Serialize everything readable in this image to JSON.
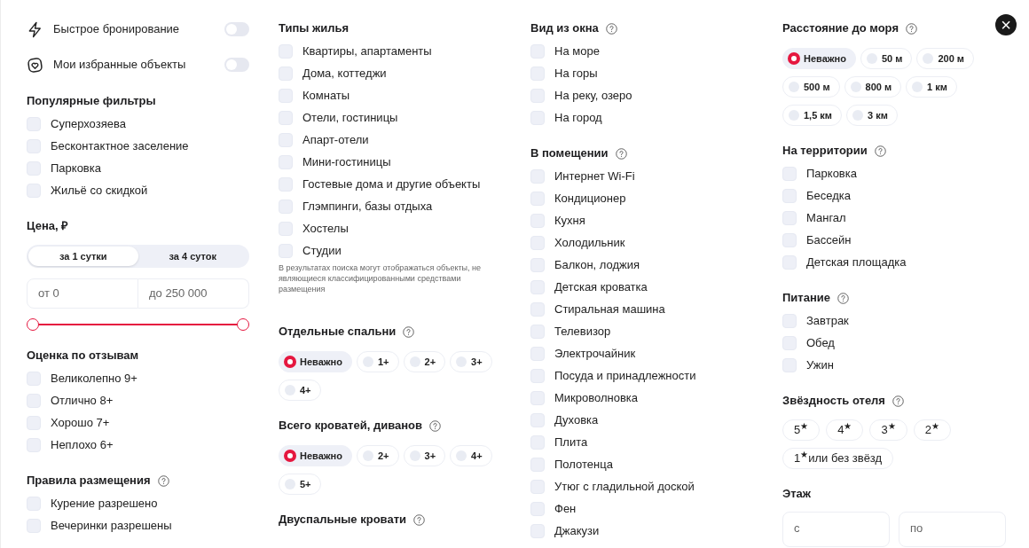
{
  "columns": [
    {
      "sections": [
        {
          "kind": "toggles",
          "items": [
            {
              "label": "Быстрое бронирование",
              "on": false
            },
            {
              "label": "Мои избранные объекты",
              "on": false
            }
          ]
        },
        {
          "kind": "checkboxes",
          "title": "Популярные фильтры",
          "help": false,
          "items": [
            {
              "label": "Суперхозяева",
              "checked": false
            },
            {
              "label": "Бесконтактное заселение",
              "checked": false
            },
            {
              "label": "Парковка",
              "checked": false
            },
            {
              "label": "Жильё со скидкой",
              "checked": false
            }
          ]
        },
        {
          "kind": "price",
          "title": "Цена, ₽",
          "help": false,
          "tabs": [
            {
              "label": "за 1 сутки",
              "selected": true
            },
            {
              "label": "за 4 суток",
              "selected": false
            }
          ],
          "from": "от 0",
          "to": "до 250 000",
          "thumbs": [
            {
              "level": 0
            },
            {
              "level": 1
            }
          ]
        },
        {
          "kind": "checkboxes",
          "title": "Оценка по отзывам",
          "help": false,
          "items": [
            {
              "label": "Великолепно 9+",
              "checked": false
            },
            {
              "label": "Отлично 8+",
              "checked": false
            },
            {
              "label": "Хорошо 7+",
              "checked": false
            },
            {
              "label": "Неплохо 6+",
              "checked": false
            }
          ]
        },
        {
          "kind": "checkboxes",
          "title": "Правила размещения",
          "help": true,
          "items": [
            {
              "label": "Курение разрешено",
              "checked": false
            },
            {
              "label": "Вечеринки разрешены",
              "checked": false
            }
          ]
        }
      ]
    },
    {
      "sections": [
        {
          "kind": "checkboxes",
          "title": "Типы жилья",
          "help": false,
          "items": [
            {
              "label": "Квартиры, апартаменты",
              "checked": false
            },
            {
              "label": "Дома, коттеджи",
              "checked": false
            },
            {
              "label": "Комнаты",
              "checked": false
            },
            {
              "label": "Отели, гостиницы",
              "checked": false
            },
            {
              "label": "Апарт-отели",
              "checked": false
            },
            {
              "label": "Мини-гостиницы",
              "checked": false
            },
            {
              "label": "Гостевые дома и другие объекты",
              "checked": false
            },
            {
              "label": "Глэмпинги, базы отдыха",
              "checked": false
            },
            {
              "label": "Хостелы",
              "checked": false
            },
            {
              "label": "Студии",
              "checked": false
            }
          ],
          "note": "В результатах поиска могут отображаться объекты, не являющиеся классифицированными средствами размещения"
        },
        {
          "kind": "radios",
          "title": "Отдельные спальни",
          "help": true,
          "items": [
            {
              "label": "Неважно",
              "selected": true
            },
            {
              "label": "1+",
              "selected": false
            },
            {
              "label": "2+",
              "selected": false
            },
            {
              "label": "3+",
              "selected": false
            },
            {
              "label": "4+",
              "selected": false
            }
          ]
        },
        {
          "kind": "radios",
          "title": "Всего кроватей, диванов",
          "help": true,
          "items": [
            {
              "label": "Неважно",
              "selected": true
            },
            {
              "label": "2+",
              "selected": false
            },
            {
              "label": "3+",
              "selected": false
            },
            {
              "label": "4+",
              "selected": false
            },
            {
              "label": "5+",
              "selected": false
            }
          ]
        },
        {
          "kind": "heading",
          "title": "Двуспальные кровати",
          "help": true
        }
      ]
    },
    {
      "sections": [
        {
          "kind": "checkboxes",
          "title": "Вид из окна",
          "help": true,
          "items": [
            {
              "label": "На море",
              "checked": false
            },
            {
              "label": "На горы",
              "checked": false
            },
            {
              "label": "На реку, озеро",
              "checked": false
            },
            {
              "label": "На город",
              "checked": false
            }
          ]
        },
        {
          "kind": "checkboxes",
          "title": "В помещении",
          "help": true,
          "items": [
            {
              "label": "Интернет Wi-Fi",
              "checked": false
            },
            {
              "label": "Кондиционер",
              "checked": false
            },
            {
              "label": "Кухня",
              "checked": false
            },
            {
              "label": "Холодильник",
              "checked": false
            },
            {
              "label": "Балкон, лоджия",
              "checked": false
            },
            {
              "label": "Детская кроватка",
              "checked": false
            },
            {
              "label": "Стиральная машина",
              "checked": false
            },
            {
              "label": "Телевизор",
              "checked": false
            },
            {
              "label": "Электрочайник",
              "checked": false
            },
            {
              "label": "Посуда и принадлежности",
              "checked": false
            },
            {
              "label": "Микроволновка",
              "checked": false
            },
            {
              "label": "Духовка",
              "checked": false
            },
            {
              "label": "Плита",
              "checked": false
            },
            {
              "label": "Полотенца",
              "checked": false
            },
            {
              "label": "Утюг с гладильной доской",
              "checked": false
            },
            {
              "label": "Фен",
              "checked": false
            },
            {
              "label": "Джакузи",
              "checked": false
            }
          ]
        }
      ]
    },
    {
      "sections": [
        {
          "kind": "radios",
          "title": "Расстояние до моря",
          "help": true,
          "items": [
            {
              "label": "Неважно",
              "selected": true
            },
            {
              "label": "50 м",
              "selected": false
            },
            {
              "label": "200 м",
              "selected": false
            },
            {
              "label": "500 м",
              "selected": false
            },
            {
              "label": "800 м",
              "selected": false
            },
            {
              "label": "1 км",
              "selected": false
            },
            {
              "label": "1,5 км",
              "selected": false
            },
            {
              "label": "3 км",
              "selected": false
            }
          ]
        },
        {
          "kind": "checkboxes",
          "title": "На территории",
          "help": true,
          "items": [
            {
              "label": "Парковка",
              "checked": false
            },
            {
              "label": "Беседка",
              "checked": false
            },
            {
              "label": "Мангал",
              "checked": false
            },
            {
              "label": "Бассейн",
              "checked": false
            },
            {
              "label": "Детская площадка",
              "checked": false
            }
          ]
        },
        {
          "kind": "checkboxes",
          "title": "Питание",
          "help": true,
          "items": [
            {
              "label": "Завтрак",
              "checked": false
            },
            {
              "label": "Обед",
              "checked": false
            },
            {
              "label": "Ужин",
              "checked": false
            }
          ]
        },
        {
          "kind": "chips",
          "title": "Звёздность отеля",
          "help": true,
          "items": [
            {
              "label": "5$^{★}$",
              "selected": false
            },
            {
              "label": "4$^{★}$",
              "selected": false
            },
            {
              "label": "3$^{★}$",
              "selected": false
            },
            {
              "label": "2$^{★}$",
              "selected": false
            },
            {
              "label": "1$^{★}$или без звёзд",
              "selected": false
            }
          ]
        },
        {
          "kind": "range_fields",
          "title": "Этаж",
          "help": false,
          "from": "с",
          "to": "по"
        }
      ]
    }
  ],
  "close": "×"
}
